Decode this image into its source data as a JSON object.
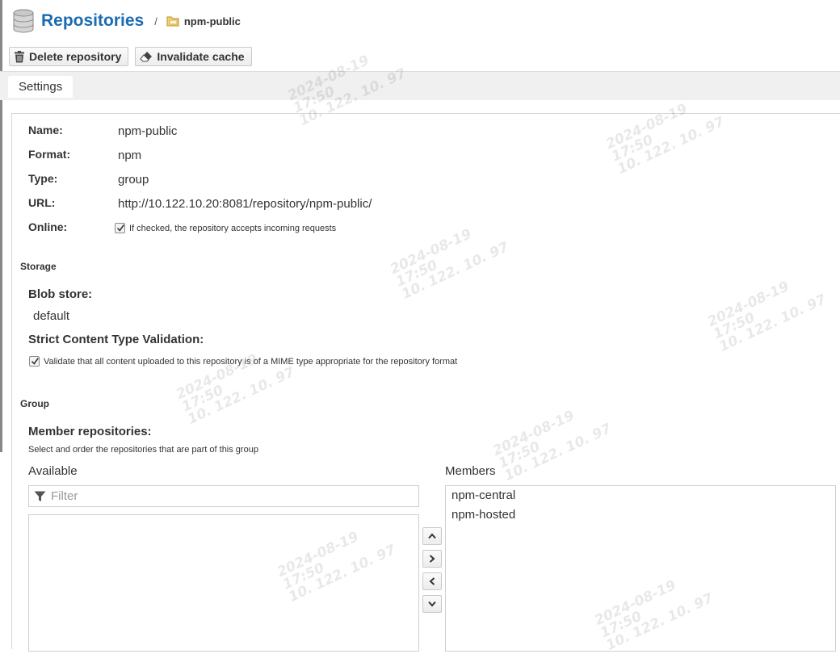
{
  "breadcrumb": {
    "title": "Repositories",
    "separator": "/",
    "current": "npm-public"
  },
  "toolbar": {
    "delete_label": "Delete repository",
    "invalidate_label": "Invalidate cache"
  },
  "tabs": [
    "Settings"
  ],
  "settings": {
    "name_label": "Name:",
    "name_value": "npm-public",
    "format_label": "Format:",
    "format_value": "npm",
    "type_label": "Type:",
    "type_value": "group",
    "url_label": "URL:",
    "url_value": "http://10.122.10.20:8081/repository/npm-public/",
    "online_label": "Online:",
    "online_checked": true,
    "online_help": "If checked, the repository accepts incoming requests"
  },
  "storage": {
    "section_title": "Storage",
    "blob_store_label": "Blob store:",
    "blob_store_value": "default",
    "strict_label": "Strict Content Type Validation:",
    "strict_checked": true,
    "strict_help": "Validate that all content uploaded to this repository is of a MIME type appropriate for the repository format"
  },
  "group": {
    "section_title": "Group",
    "members_label": "Member repositories:",
    "members_help": "Select and order the repositories that are part of this group",
    "available_header": "Available",
    "filter_placeholder": "Filter",
    "available_items": [],
    "members_header": "Members",
    "member_items": [
      "npm-central",
      "npm-hosted"
    ]
  },
  "watermark": {
    "line1": "2024-08-19",
    "line2": "17:50",
    "line3": "10. 122. 10. 97"
  },
  "colors": {
    "link_blue": "#1a6bb0",
    "tab_strip": "#f0f0f0"
  }
}
